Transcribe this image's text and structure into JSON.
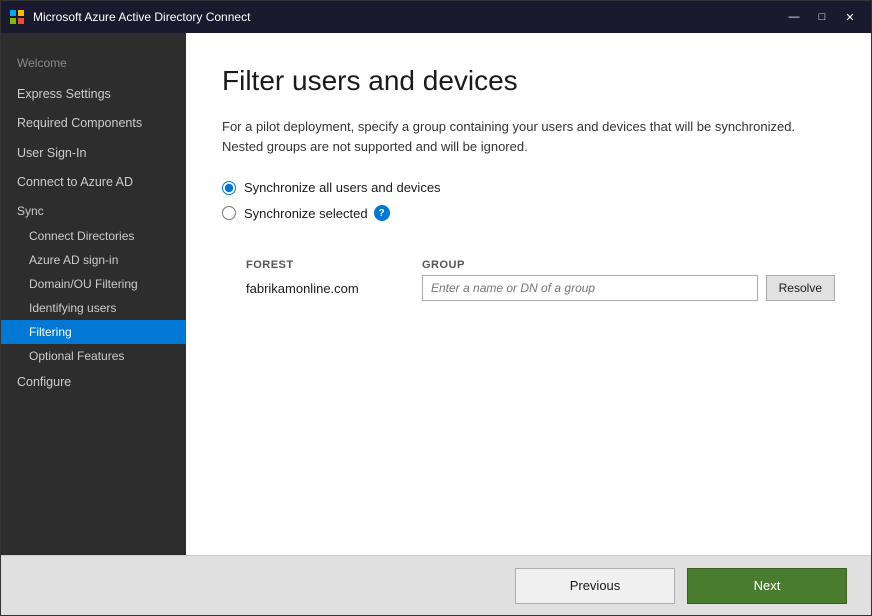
{
  "window": {
    "title": "Microsoft Azure Active Directory Connect",
    "minimize_label": "—",
    "maximize_label": "□",
    "close_label": "✕"
  },
  "sidebar": {
    "welcome_label": "Welcome",
    "items": [
      {
        "id": "express-settings",
        "label": "Express Settings",
        "level": "top",
        "active": false
      },
      {
        "id": "required-components",
        "label": "Required Components",
        "level": "top",
        "active": false
      },
      {
        "id": "user-sign-in",
        "label": "User Sign-In",
        "level": "top",
        "active": false
      },
      {
        "id": "connect-azure-ad",
        "label": "Connect to Azure AD",
        "level": "top",
        "active": false
      },
      {
        "id": "sync",
        "label": "Sync",
        "level": "group"
      },
      {
        "id": "connect-directories",
        "label": "Connect Directories",
        "level": "sub",
        "active": false
      },
      {
        "id": "azure-ad-sign-in",
        "label": "Azure AD sign-in",
        "level": "sub",
        "active": false
      },
      {
        "id": "domain-ou-filtering",
        "label": "Domain/OU Filtering",
        "level": "sub",
        "active": false
      },
      {
        "id": "identifying-users",
        "label": "Identifying users",
        "level": "sub",
        "active": false
      },
      {
        "id": "filtering",
        "label": "Filtering",
        "level": "sub",
        "active": true
      },
      {
        "id": "optional-features",
        "label": "Optional Features",
        "level": "sub",
        "active": false
      },
      {
        "id": "configure",
        "label": "Configure",
        "level": "top",
        "active": false
      }
    ]
  },
  "content": {
    "page_title": "Filter users and devices",
    "description": "For a pilot deployment, specify a group containing your users and devices that will be synchronized. Nested groups are not supported and will be ignored.",
    "radio_all_label": "Synchronize all users and devices",
    "radio_selected_label": "Synchronize selected",
    "table": {
      "col_forest": "FOREST",
      "col_group": "GROUP",
      "row_forest": "fabrikamonline.com",
      "group_placeholder": "Enter a name or DN of a group",
      "resolve_btn_label": "Resolve"
    }
  },
  "footer": {
    "previous_label": "Previous",
    "next_label": "Next"
  },
  "colors": {
    "active_sidebar": "#0078d4",
    "next_btn": "#4a7c2f",
    "titlebar": "#1a1a2e"
  }
}
